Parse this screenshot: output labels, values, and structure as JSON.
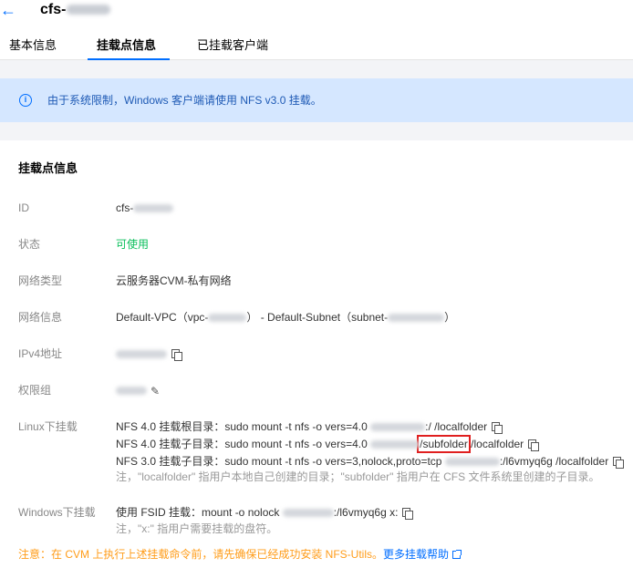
{
  "header": {
    "title": "cfs-",
    "tabs": [
      "基本信息",
      "挂载点信息",
      "已挂载客户端"
    ]
  },
  "notice": {
    "text": "由于系统限制，Windows 客户端请使用 NFS v3.0 挂载。"
  },
  "mount_info": {
    "section_title": "挂载点信息",
    "labels": {
      "id": "ID",
      "status": "状态",
      "network_type": "网络类型",
      "network_info": "网络信息",
      "ipv4": "IPv4地址",
      "permission_group": "权限组",
      "linux_mount": "Linux下挂载",
      "windows_mount": "Windows下挂载"
    },
    "id_prefix": "cfs-",
    "status": "可使用",
    "network_type": "云服务器CVM-私有网络",
    "network_vpc_prefix": "Default-VPC（vpc-",
    "network_subnet_prefix": "） - Default-Subnet（subnet-",
    "network_suffix": "）",
    "linux": {
      "line1_prefix": "NFS 4.0 挂载根目录：sudo mount -t nfs -o vers=4.0 ",
      "line1_suffix": ":/ /localfolder",
      "line2_prefix": "NFS 4.0 挂载子目录：sudo mount -t nfs -o vers=4.0 ",
      "line2_highlight": "/subfolder",
      "line2_suffix": " /localfolder",
      "line3_prefix": "NFS 3.0 挂载子目录：sudo mount -t nfs -o vers=3,nolock,proto=tcp ",
      "line3_suffix": ":/l6vmyq6g /localfolder",
      "note": "注，\"localfolder\" 指用户本地自己创建的目录；\"subfolder\" 指用户在 CFS 文件系统里创建的子目录。"
    },
    "windows": {
      "command_prefix": "使用 FSID 挂载：mount -o nolock ",
      "command_suffix": ":/l6vmyq6g x:",
      "note": "注，\"x:\" 指用户需要挂载的盘符。"
    },
    "warning": "注意：在 CVM 上执行上述挂载命令前，请先确保已经成功安装 NFS-Utils。",
    "help_link": "更多挂载帮助"
  },
  "icons": {
    "back": "arrow-left-icon",
    "info": "info-circle-icon",
    "copy": "copy-icon",
    "edit": "pencil-icon",
    "external": "external-link-icon"
  },
  "colors": {
    "accent": "#006eff",
    "success": "#0abf5b",
    "warning": "#ff9c19",
    "highlight_border": "#e01f1f",
    "notice_bg": "#d5e7ff"
  }
}
